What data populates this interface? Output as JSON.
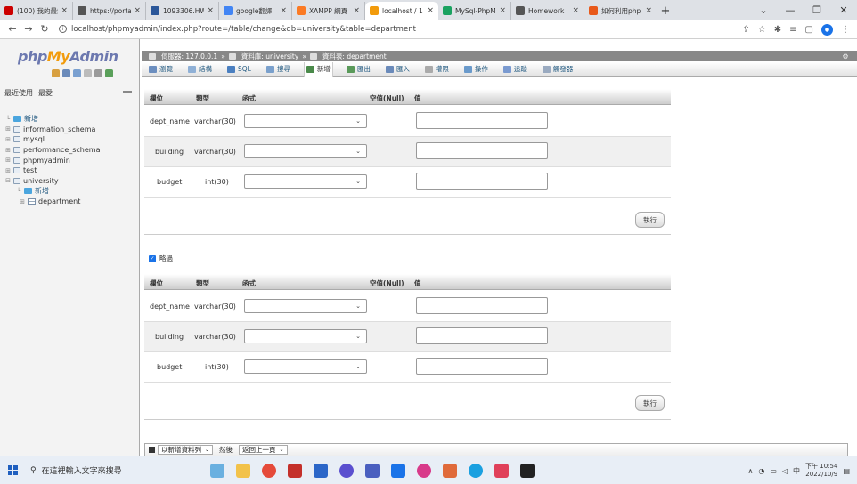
{
  "browser": {
    "tabs": [
      {
        "label": "(100) 我的最愛",
        "color": "#cc0000",
        "active": false
      },
      {
        "label": "https://porta",
        "color": "#555555",
        "active": false
      },
      {
        "label": "1093306.HW",
        "color": "#2b579a",
        "active": false
      },
      {
        "label": "google翻譯",
        "color": "#4285f4",
        "active": false
      },
      {
        "label": "XAMPP 網頁",
        "color": "#fb7a24",
        "active": false
      },
      {
        "label": "localhost / 1",
        "color": "#f29b0c",
        "active": true
      },
      {
        "label": "MySql-PhpM",
        "color": "#1aa260",
        "active": false
      },
      {
        "label": "Homework",
        "color": "#555555",
        "active": false
      },
      {
        "label": "如何利用php",
        "color": "#e8591a",
        "active": false
      }
    ],
    "url": "localhost/phpmyadmin/index.php?route=/table/change&db=university&table=department"
  },
  "sidebar": {
    "logo_php": "php",
    "logo_my": "My",
    "logo_admin": "Admin",
    "recent": "最近使用",
    "favorites": "最愛",
    "tree": [
      {
        "label": "新增",
        "type": "new",
        "level": 0
      },
      {
        "label": "information_schema",
        "type": "db",
        "level": 0
      },
      {
        "label": "mysql",
        "type": "db",
        "level": 0
      },
      {
        "label": "performance_schema",
        "type": "db",
        "level": 0
      },
      {
        "label": "phpmyadmin",
        "type": "db",
        "level": 0
      },
      {
        "label": "test",
        "type": "db",
        "level": 0
      },
      {
        "label": "university",
        "type": "db",
        "level": 0
      },
      {
        "label": "新增",
        "type": "new",
        "level": 1
      },
      {
        "label": "department",
        "type": "table",
        "level": 1
      }
    ]
  },
  "breadcrumb": {
    "server": "伺服器: 127.0.0.1",
    "database": "資料庫: university",
    "table": "資料表: department"
  },
  "menu": {
    "tabs": [
      {
        "label": "瀏覽",
        "color": "#6c8ebf",
        "active": false
      },
      {
        "label": "結構",
        "color": "#8fb0d6",
        "active": false
      },
      {
        "label": "SQL",
        "color": "#4a7fc0",
        "active": false
      },
      {
        "label": "搜尋",
        "color": "#7aa0cc",
        "active": false
      },
      {
        "label": "新增",
        "color": "#4a8a4a",
        "active": true
      },
      {
        "label": "匯出",
        "color": "#5a9a5a",
        "active": false
      },
      {
        "label": "匯入",
        "color": "#6a8aba",
        "active": false
      },
      {
        "label": "權限",
        "color": "#aaaaaa",
        "active": false
      },
      {
        "label": "操作",
        "color": "#6a9acb",
        "active": false
      },
      {
        "label": "追蹤",
        "color": "#7a9ad0",
        "active": false
      },
      {
        "label": "觸發器",
        "color": "#9aaac0",
        "active": false
      }
    ]
  },
  "form": {
    "headers": {
      "column": "欄位",
      "type": "類型",
      "function": "函式",
      "null": "空值(Null)",
      "value": "值"
    },
    "rows": [
      {
        "name": "dept_name",
        "type": "varchar(30)",
        "value": ""
      },
      {
        "name": "building",
        "type": "varchar(30)",
        "value": ""
      },
      {
        "name": "budget",
        "type": "int(30)",
        "value": ""
      }
    ],
    "go_label": "執行",
    "ignore_label": "略過"
  },
  "bottom": {
    "insert_label": "以新增資料列",
    "then_label": "然後",
    "back_label": "返回上一頁"
  },
  "taskbar": {
    "search_placeholder": "在這裡輸入文字來搜尋",
    "time": "下午 10:54",
    "date": "2022/10/9",
    "ime": "中"
  }
}
